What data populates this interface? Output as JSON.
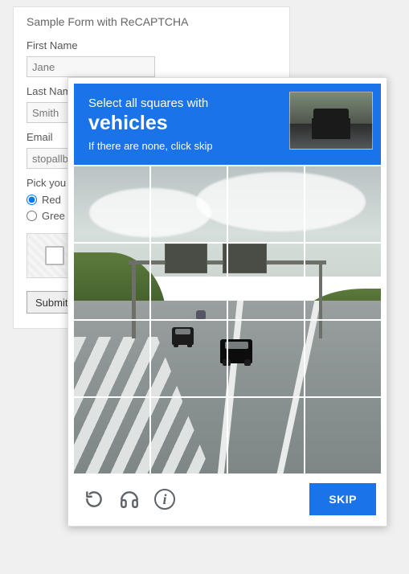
{
  "form": {
    "title": "Sample Form with ReCAPTCHA",
    "first_name_label": "First Name",
    "first_name_value": "Jane",
    "last_name_label": "Last Name",
    "last_name_value": "Smith",
    "email_label": "Email",
    "email_value": "stopallb",
    "color_label": "Pick you",
    "color_options": {
      "red": "Red",
      "green": "Gree"
    },
    "submit_label": "Submit"
  },
  "challenge": {
    "instruction_line1": "Select all squares with",
    "target_word": "vehicles",
    "instruction_line3": "If there are none, click skip",
    "skip_label": "SKIP",
    "grid_rows": 4,
    "grid_cols": 4
  },
  "colors": {
    "accent_blue": "#1a73e8"
  }
}
